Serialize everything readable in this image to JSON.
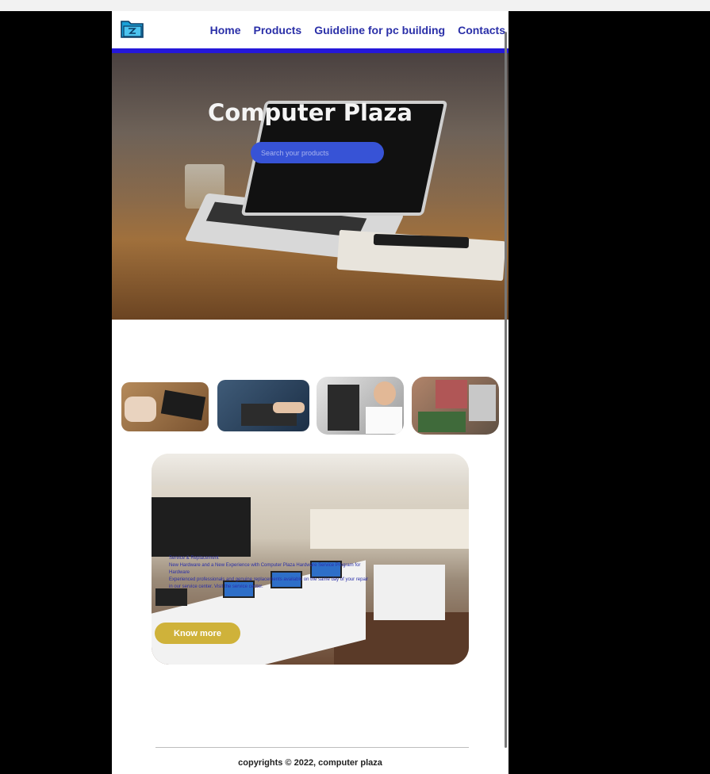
{
  "nav": {
    "logo": "folder-logo-icon",
    "items": [
      "Home",
      "Products",
      "Guideline for pc building",
      "Contacts"
    ]
  },
  "hero": {
    "title": "Computer Plaza",
    "search_placeholder": "Search your products"
  },
  "store": {
    "caption_lines": [
      "Service & Replacement",
      "New Hardware and a New Experience with Computer Plaza Hardware Service Program for",
      "Hardware",
      "Experienced professionals and genuine replacements available on the same day of your repair",
      "in our service center. Visit the service center."
    ],
    "button_label": "Know more"
  },
  "footer": {
    "copyright": "copyrights © 2022, computer plaza"
  },
  "colors": {
    "nav_text": "#2a2fa8",
    "nav_line": "#2518d9",
    "search_bg": "#3753d6",
    "button_bg": "#cfb23a"
  }
}
